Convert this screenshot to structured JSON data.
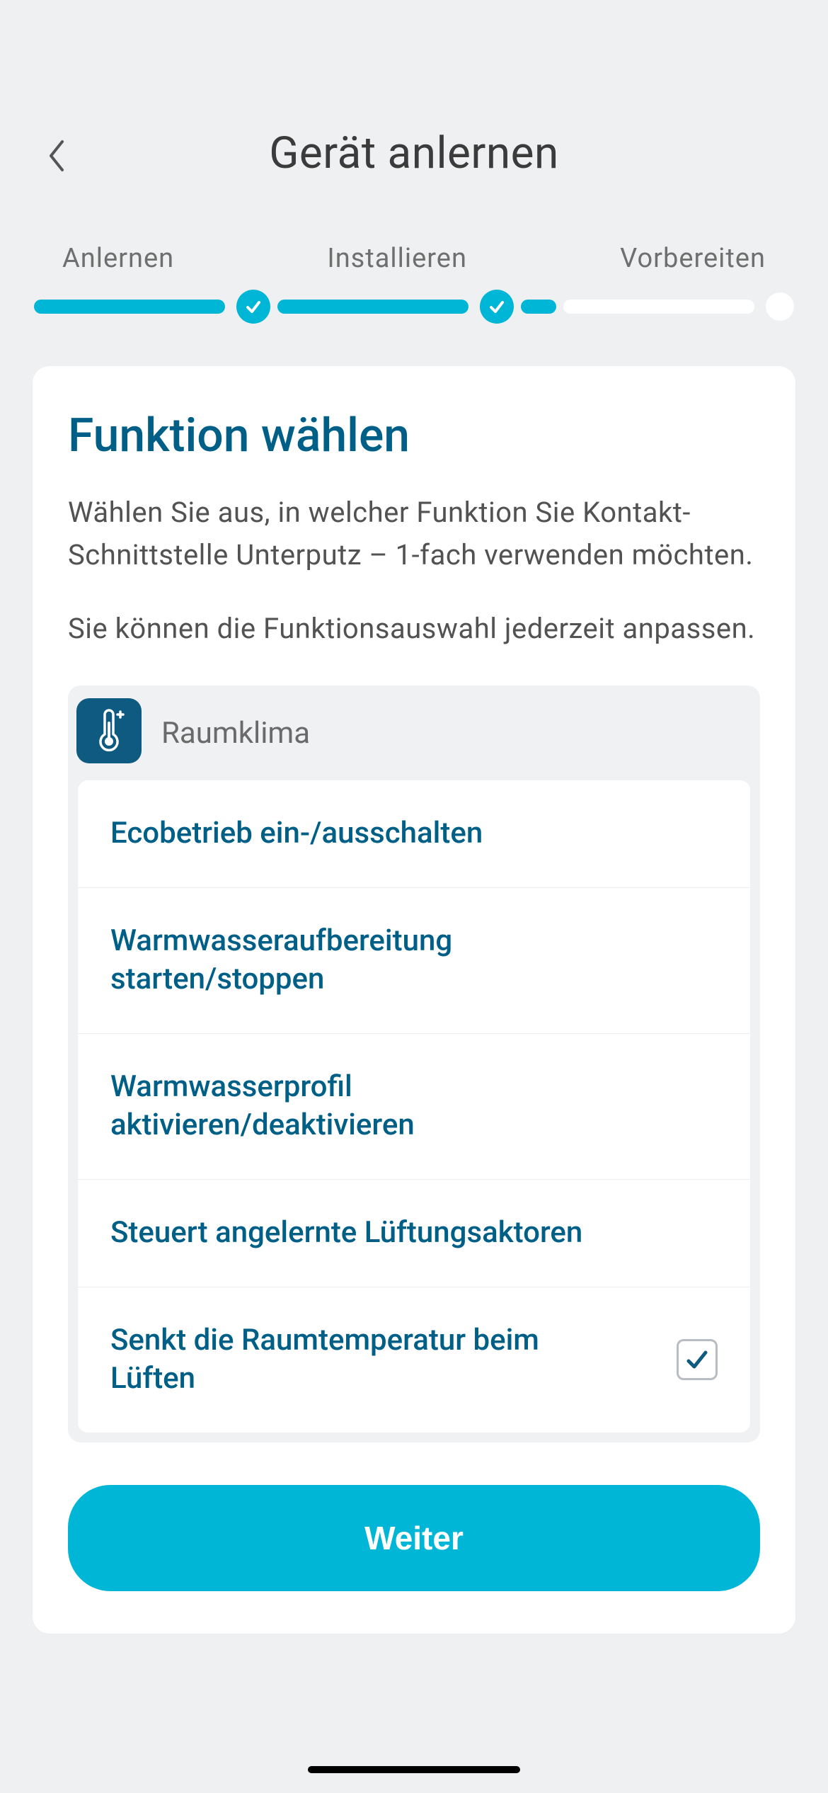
{
  "header": {
    "title": "Gerät anlernen"
  },
  "stepper": {
    "step1": "Anlernen",
    "step2": "Installieren",
    "step3": "Vorbereiten"
  },
  "card": {
    "title": "Funktion wählen",
    "desc1": "Wählen Sie aus, in welcher Funktion Sie Kontakt-Schnittstelle Unterputz – 1-fach verwenden möchten.",
    "desc2": "Sie können die Funktionsauswahl jederzeit anpassen."
  },
  "group": {
    "title": "Raumklima",
    "items": [
      {
        "label": "Ecobetrieb ein-/ausschalten",
        "checked": false
      },
      {
        "label": "Warmwasseraufbereitung starten/stoppen",
        "checked": false
      },
      {
        "label": "Warmwasserprofil aktivieren/deaktivieren",
        "checked": false
      },
      {
        "label": "Steuert angelernte Lüftungsaktoren",
        "checked": false
      },
      {
        "label": "Senkt die Raumtemperatur beim Lüften",
        "checked": true
      }
    ]
  },
  "cta": {
    "label": "Weiter"
  }
}
